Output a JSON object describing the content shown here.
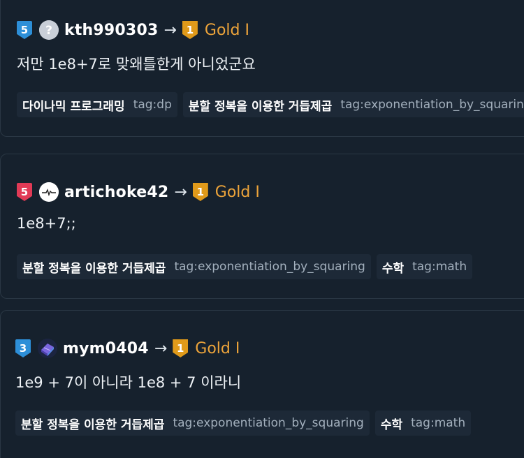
{
  "entries": [
    {
      "user": {
        "name": "kth990303",
        "tier_badge": "5",
        "tier_color": "#2d8fd8",
        "avatar_icon": "question-circle-icon"
      },
      "new_tier": {
        "badge": "1",
        "label": "Gold I"
      },
      "arrow": "→",
      "comment": "저만 1e8+7로 맞왜틀한게 아니었군요",
      "tags": [
        {
          "name": "다이나믹 프로그래밍",
          "key": "tag:dp"
        },
        {
          "name": "분할 정복을 이용한 거듭제곱",
          "key": "tag:exponentiation_by_squaring"
        }
      ]
    },
    {
      "user": {
        "name": "artichoke42",
        "tier_badge": "5",
        "tier_color": "#e13a56",
        "avatar_icon": "heartbeat-avatar-icon"
      },
      "new_tier": {
        "badge": "1",
        "label": "Gold I"
      },
      "arrow": "→",
      "comment": "1e8+7;;",
      "tags": [
        {
          "name": "분할 정복을 이용한 거듭제곱",
          "key": "tag:exponentiation_by_squaring"
        },
        {
          "name": "수학",
          "key": "tag:math"
        }
      ]
    },
    {
      "user": {
        "name": "mym0404",
        "tier_badge": "3",
        "tier_color": "#2d8fd8",
        "avatar_icon": "gem-avatar-icon"
      },
      "new_tier": {
        "badge": "1",
        "label": "Gold I"
      },
      "arrow": "→",
      "comment": "1e9 + 7이 아니라 1e8 + 7 이라니",
      "tags": [
        {
          "name": "분할 정복을 이용한 거듭제곱",
          "key": "tag:exponentiation_by_squaring"
        },
        {
          "name": "수학",
          "key": "tag:math"
        }
      ]
    }
  ],
  "colors": {
    "background": "#16212d",
    "gold": "#eda43a",
    "tag_bg": "#1d2937"
  }
}
